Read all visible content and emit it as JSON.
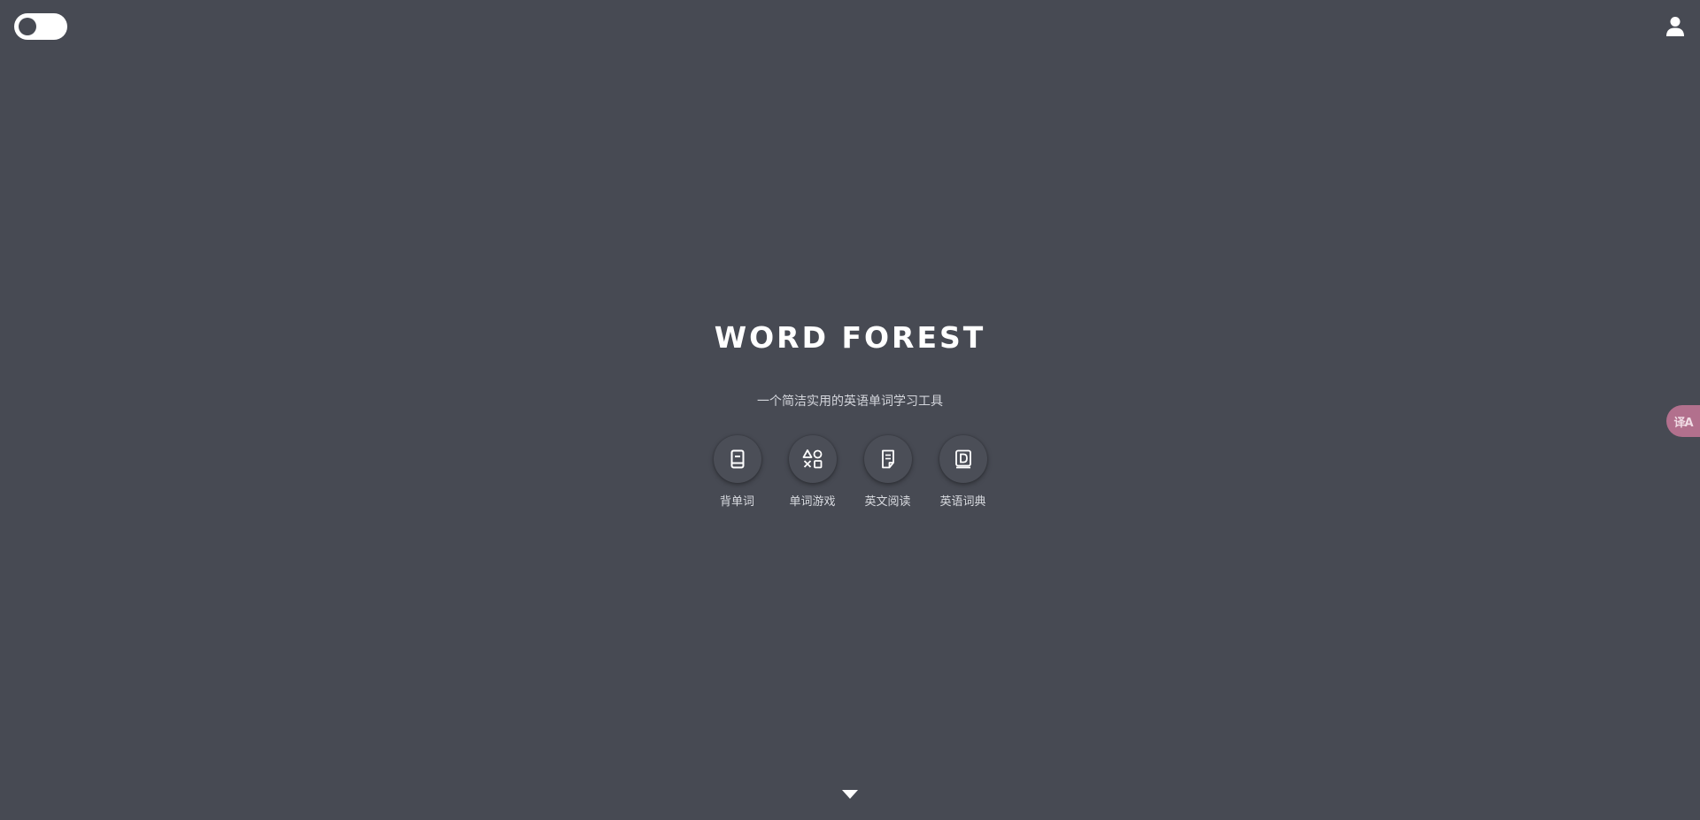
{
  "header": {
    "theme_toggle_state": "off",
    "user_icon": "user-icon"
  },
  "hero": {
    "title": "WORD FOREST",
    "subtitle": "一个简洁实用的英语单词学习工具"
  },
  "features": [
    {
      "label": "背单词",
      "icon": "book-icon"
    },
    {
      "label": "单词游戏",
      "icon": "shapes-icon"
    },
    {
      "label": "英文阅读",
      "icon": "document-icon"
    },
    {
      "label": "英语词典",
      "icon": "dictionary-icon"
    }
  ],
  "translate_button": {
    "glyph": "译A",
    "icon": "translate-icon"
  },
  "scroll_indicator": {
    "icon": "caret-down-icon"
  },
  "colors": {
    "background": "#474a53",
    "toggle": "#ffffff",
    "translate_accent": "#b2708d"
  }
}
